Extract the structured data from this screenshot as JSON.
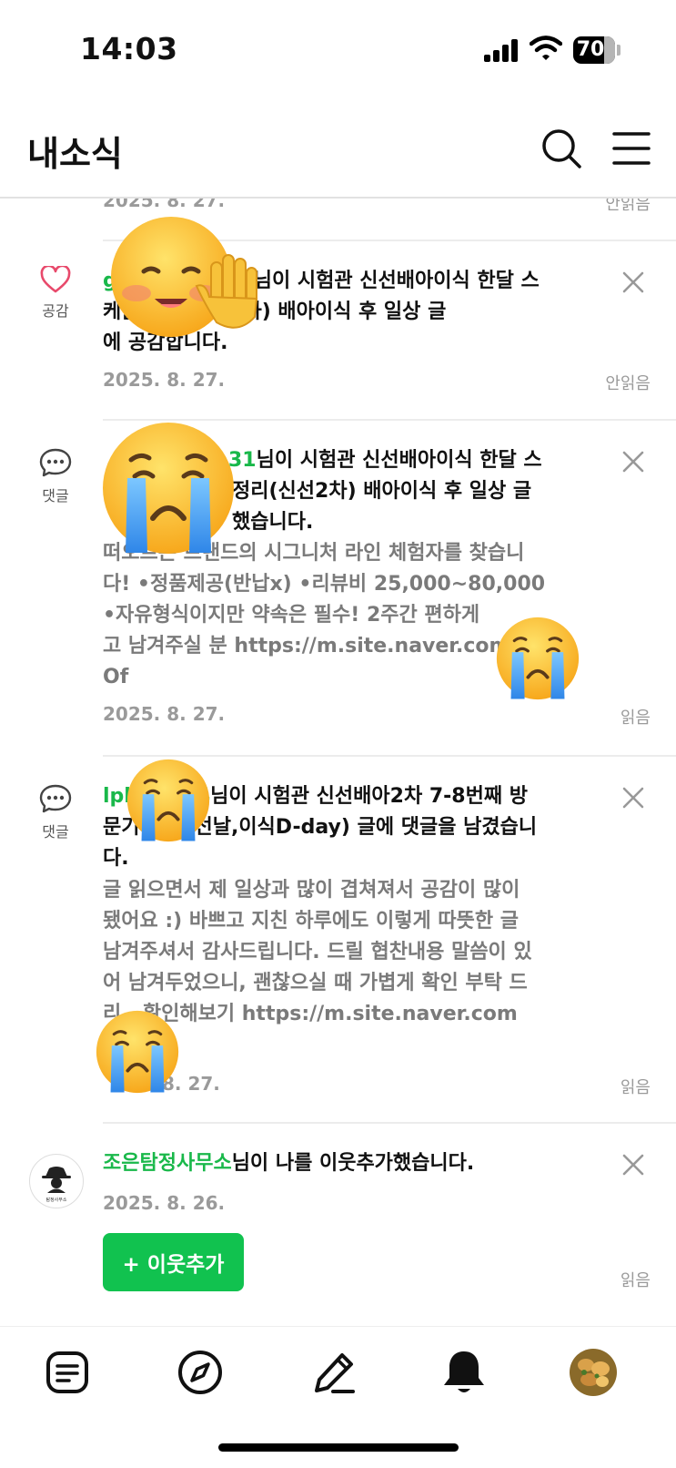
{
  "status": {
    "time": "14:03",
    "battery": "70"
  },
  "header": {
    "title": "내소식"
  },
  "partial_item": {
    "date": "2025. 8. 27.",
    "read": "안읽음"
  },
  "notifications": [
    {
      "type_label": "공감",
      "icon": "heart-icon",
      "nick": "g",
      "message": "님이 시험관 신선배아이식 한달 스케줄 정리(신선2차) 배아이식 후 일상 글에 공감합니다.",
      "line1": "님이 시험관 신선배아이식 한달 스",
      "line2": "케줄 정리(신선2차) 배아이식 후 일상 글",
      "line3": "에 공감합니다.",
      "date": "2025. 8. 27.",
      "read": "안읽음"
    },
    {
      "type_label": "댓글",
      "icon": "comment-icon",
      "nick": "31",
      "line1": "님이 시험관 신선배아이식 한달 스",
      "line2": "정리(신선2차) 배아이식 후 일상 글",
      "line3": "했습니다.",
      "preview": [
        "떠오르는 브랜드의 시그니처 라인 체험자를 찾습니",
        "다!  •정품제공(반납x) •리뷰비 25,000~80,000",
        "•자유형식이지만 약속은 필수!  2주간 편하게",
        "고 남겨주실 분 https://m.site.naver.com",
        "Of"
      ],
      "date": "2025. 8. 27.",
      "read": "읽음"
    },
    {
      "type_label": "댓글",
      "icon": "comment-icon",
      "nick": "lpl",
      "nick_tail": "4",
      "line1": "님이 시험관 신선배아2차 7-8번째 방",
      "line2": "문기",
      "line2b": "선날,이식D-day) 글에 댓글을 남겼습니",
      "line3": "다.",
      "preview": [
        "글 읽으면서 제 일상과 많이 겹쳐져서 공감이 많이",
        "됐어요 :) 바쁘고 지친 하루에도 이렇게 따뜻한 글",
        "남겨주셔서 감사드립니다. 드릴 협찬내용 말씀이 있",
        "어 남겨두었으니, 괜찮으실 때 가볍게 확인 부탁 드",
        "리    .   확인해보기 https://m.site.naver.com"
      ],
      "date_tail": "8. 27.",
      "read": "읽음"
    },
    {
      "icon": "detective-avatar",
      "avatar_text": "탐정사무소",
      "nick": "조은탐정사무소",
      "message": "님이 나를 이웃추가했습니다.",
      "date": "2025. 8. 26.",
      "button": "+ 이웃추가",
      "read": "읽음"
    }
  ],
  "tabbar": [
    "feed-icon",
    "compass-icon",
    "write-icon",
    "bell-icon",
    "profile-avatar"
  ],
  "colors": {
    "nick_green": "#19b84a",
    "follow_button": "#11c24f",
    "heart_pink": "#e8496b"
  }
}
